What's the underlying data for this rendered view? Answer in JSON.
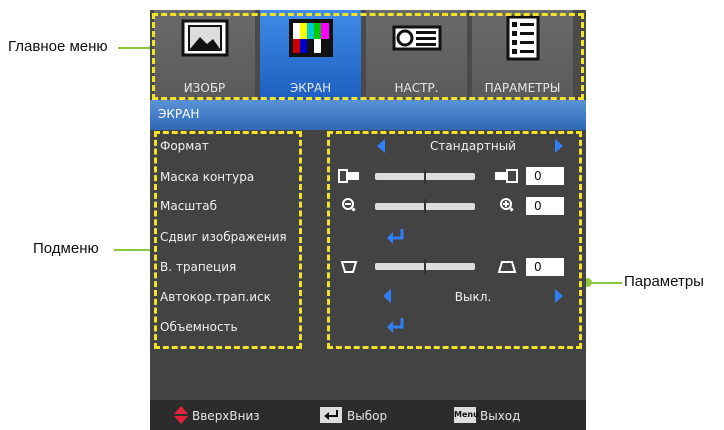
{
  "callouts": {
    "main_menu": "Главное меню",
    "submenu": "Подменю",
    "parameters": "Параметры"
  },
  "tabs": [
    {
      "label": "ИЗОБР",
      "icon": "picture-icon"
    },
    {
      "label": "ЭКРАН",
      "icon": "screen-icon"
    },
    {
      "label": "НАСТР.",
      "icon": "projector-icon"
    },
    {
      "label": "ПАРАМЕТРЫ",
      "icon": "options-icon"
    }
  ],
  "active_tab": "ЭКРАН",
  "section_title": "ЭКРАН",
  "menu_items": [
    "Формат",
    "Маска контура",
    "Масштаб",
    "Сдвиг изображения",
    "В. трапеция",
    "Автокор.трап.иск",
    "Объемность"
  ],
  "values": {
    "format": "Стандартный",
    "mask_value": "0",
    "zoom_value": "0",
    "keystone_value": "0",
    "auto_keystone": "Выкл."
  },
  "sliders": {
    "mask": 0.5,
    "zoom": 0.5,
    "keystone": 0.5
  },
  "footer": {
    "updown": "ВверхВниз",
    "select": "Выбор",
    "menu_key": "Menu",
    "exit": "Выход"
  },
  "colors": {
    "accent": "#2f7ef3",
    "dash": "#f2e22b",
    "callout_line": "#8dc63f"
  }
}
